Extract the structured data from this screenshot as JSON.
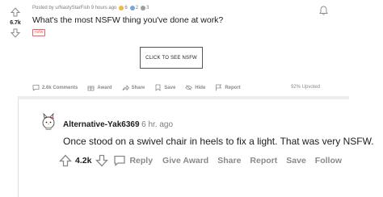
{
  "post": {
    "score": "6.7k",
    "meta": "Posted by u/NastyStarFish 9 hours ago",
    "awards": [
      {
        "count": "6",
        "color": "#f4b740"
      },
      {
        "count": "2",
        "color": "#7aa6d8"
      },
      {
        "count": "3",
        "color": "#9e9e9e"
      }
    ],
    "title": "What's the most NSFW thing you've done at work?",
    "flair": "nsfw",
    "reveal_button": "CLICK TO SEE NSFW",
    "actions": {
      "comments": "2.6k Comments",
      "award": "Award",
      "share": "Share",
      "save": "Save",
      "hide": "Hide",
      "report": "Report"
    },
    "upvoted": "92% Upvoted"
  },
  "comment": {
    "author": "Alternative-Yak6369",
    "time": "· 6 hr. ago",
    "body": "Once stood on a swivel chair in heels to fix a light. That was very NSFW.",
    "score": "4.2k",
    "actions": {
      "reply": "Reply",
      "give_award": "Give Award",
      "share": "Share",
      "report": "Report",
      "save": "Save",
      "follow": "Follow"
    }
  },
  "colors": {
    "nsfw": "#ff585b",
    "muted": "#878a8c",
    "text": "#1c1c1c"
  }
}
